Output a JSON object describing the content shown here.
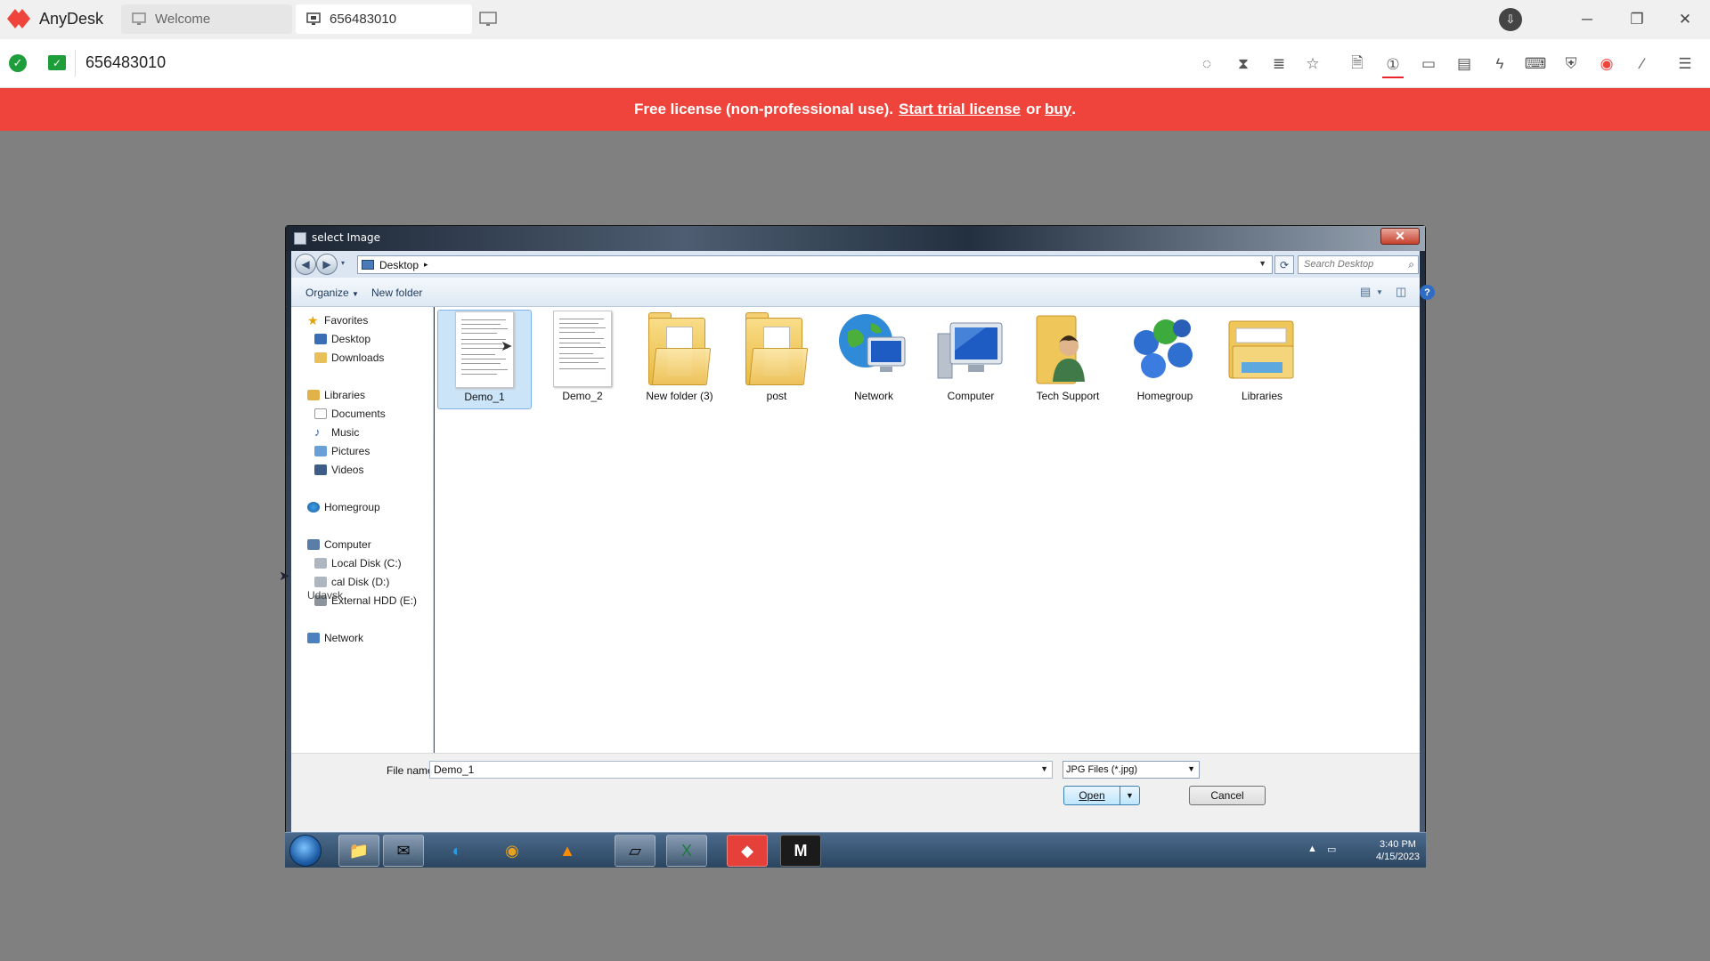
{
  "anydesk": {
    "app_name": "AnyDesk",
    "tabs": [
      {
        "label": "Welcome"
      },
      {
        "label": "656483010"
      }
    ],
    "address": "656483010",
    "colors": {
      "brand": "#ef443b",
      "ok": "#1e9e3a"
    },
    "toolbar_icons": [
      "privacy-icon",
      "hourglass-icon",
      "database-icon",
      "star-icon",
      "file-transfer-icon",
      "monitor-1-icon",
      "display-icon",
      "chat-icon",
      "lightning-icon",
      "keyboard-icon",
      "permissions-icon",
      "record-icon",
      "pen-icon",
      "menu-icon"
    ],
    "banner": {
      "prefix": "Free license (non-professional use).",
      "trial_link": "Start trial license",
      "or": "or",
      "buy_link": "buy",
      "suffix": "."
    }
  },
  "dialog": {
    "title": "select Image",
    "close": "✕",
    "breadcrumb": "Desktop",
    "search_placeholder": "Search Desktop",
    "commands": {
      "organize": "Organize",
      "new_folder": "New folder"
    },
    "nav": {
      "favorites": "Favorites",
      "desktop": "Desktop",
      "downloads": "Downloads",
      "libraries": "Libraries",
      "documents": "Documents",
      "music": "Music",
      "pictures": "Pictures",
      "videos": "Videos",
      "homegroup": "Homegroup",
      "computer": "Computer",
      "local_c": "Local Disk (C:)",
      "local_d": "cal Disk (D:)",
      "external_e": "External HDD (E:)",
      "network": "Network"
    },
    "files": [
      {
        "name": "Demo_1",
        "type": "image",
        "selected": true
      },
      {
        "name": "Demo_2",
        "type": "image"
      },
      {
        "name": "New folder (3)",
        "type": "folder"
      },
      {
        "name": "post",
        "type": "folder"
      },
      {
        "name": "Network",
        "type": "network"
      },
      {
        "name": "Computer",
        "type": "computer"
      },
      {
        "name": "Tech Support",
        "type": "user-folder"
      },
      {
        "name": "Homegroup",
        "type": "homegroup"
      },
      {
        "name": "Libraries",
        "type": "libraries"
      }
    ],
    "file_name_label": "File name:",
    "file_name_value": "Demo_1",
    "file_type": "JPG Files (*.jpg)",
    "open": "Open",
    "cancel": "Cancel"
  },
  "remote_cursor_tooltip": "Udavsk",
  "taskbar": {
    "time": "3:40 PM",
    "date": "4/15/2023",
    "apps": [
      "explorer-icon",
      "mail-icon",
      "edge-icon",
      "chrome-icon",
      "vlc-icon",
      "notes-icon",
      "excel-icon",
      "anydesk-icon",
      "metro-icon"
    ]
  }
}
